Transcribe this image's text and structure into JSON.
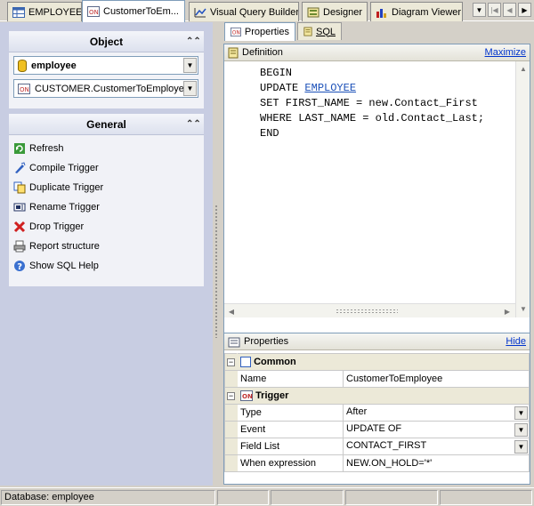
{
  "tabs": [
    {
      "label": "EMPLOYEE",
      "icon": "table-icon"
    },
    {
      "label": "CustomerToEm...",
      "icon": "trigger-icon"
    },
    {
      "label": "Visual Query Builder",
      "icon": "query-builder-icon"
    },
    {
      "label": "Designer",
      "icon": "designer-icon"
    },
    {
      "label": "Diagram Viewer",
      "icon": "diagram-icon"
    }
  ],
  "nav": {
    "down": "▼",
    "first": "|◀",
    "prev": "◀",
    "next": "▶"
  },
  "object_panel": {
    "title": "Object",
    "database": "employee",
    "object": "CUSTOMER.CustomerToEmployee"
  },
  "general_panel": {
    "title": "General",
    "actions": [
      {
        "label": "Refresh",
        "icon": "refresh-icon"
      },
      {
        "label": "Compile Trigger",
        "icon": "compile-icon"
      },
      {
        "label": "Duplicate Trigger",
        "icon": "duplicate-icon"
      },
      {
        "label": "Rename Trigger",
        "icon": "rename-icon"
      },
      {
        "label": "Drop Trigger",
        "icon": "drop-icon"
      },
      {
        "label": "Report structure",
        "icon": "report-icon"
      },
      {
        "label": "Show SQL Help",
        "icon": "help-icon"
      }
    ]
  },
  "subtabs": [
    {
      "label": "Properties"
    },
    {
      "label": "SQL"
    }
  ],
  "definition": {
    "title": "Definition",
    "maximize": "Maximize",
    "lines": [
      {
        "a": "BEGIN",
        "link": "",
        "b": ""
      },
      {
        "a": "UPDATE ",
        "link": "EMPLOYEE",
        "b": ""
      },
      {
        "a": "SET FIRST_NAME = new.Contact_First",
        "link": "",
        "b": ""
      },
      {
        "a": "WHERE LAST_NAME = old.Contact_Last;",
        "link": "",
        "b": ""
      },
      {
        "a": "END",
        "link": "",
        "b": ""
      }
    ]
  },
  "properties": {
    "title": "Properties",
    "hide": "Hide",
    "common": {
      "label": "Common",
      "name_label": "Name",
      "name_value": "CustomerToEmployee"
    },
    "trigger": {
      "label": "Trigger",
      "rows": [
        {
          "name": "Type",
          "value": "After",
          "dropdown": true
        },
        {
          "name": "Event",
          "value": "UPDATE OF",
          "dropdown": true
        },
        {
          "name": "Field List",
          "value": "CONTACT_FIRST",
          "dropdown": true
        },
        {
          "name": "When expression",
          "value": "NEW.ON_HOLD='*'",
          "dropdown": false
        }
      ]
    }
  },
  "status": {
    "database": "Database: employee"
  },
  "colors": {
    "left_bg": "#c8cde2",
    "link": "#0033cc",
    "panel_head": "#dde1ee"
  }
}
